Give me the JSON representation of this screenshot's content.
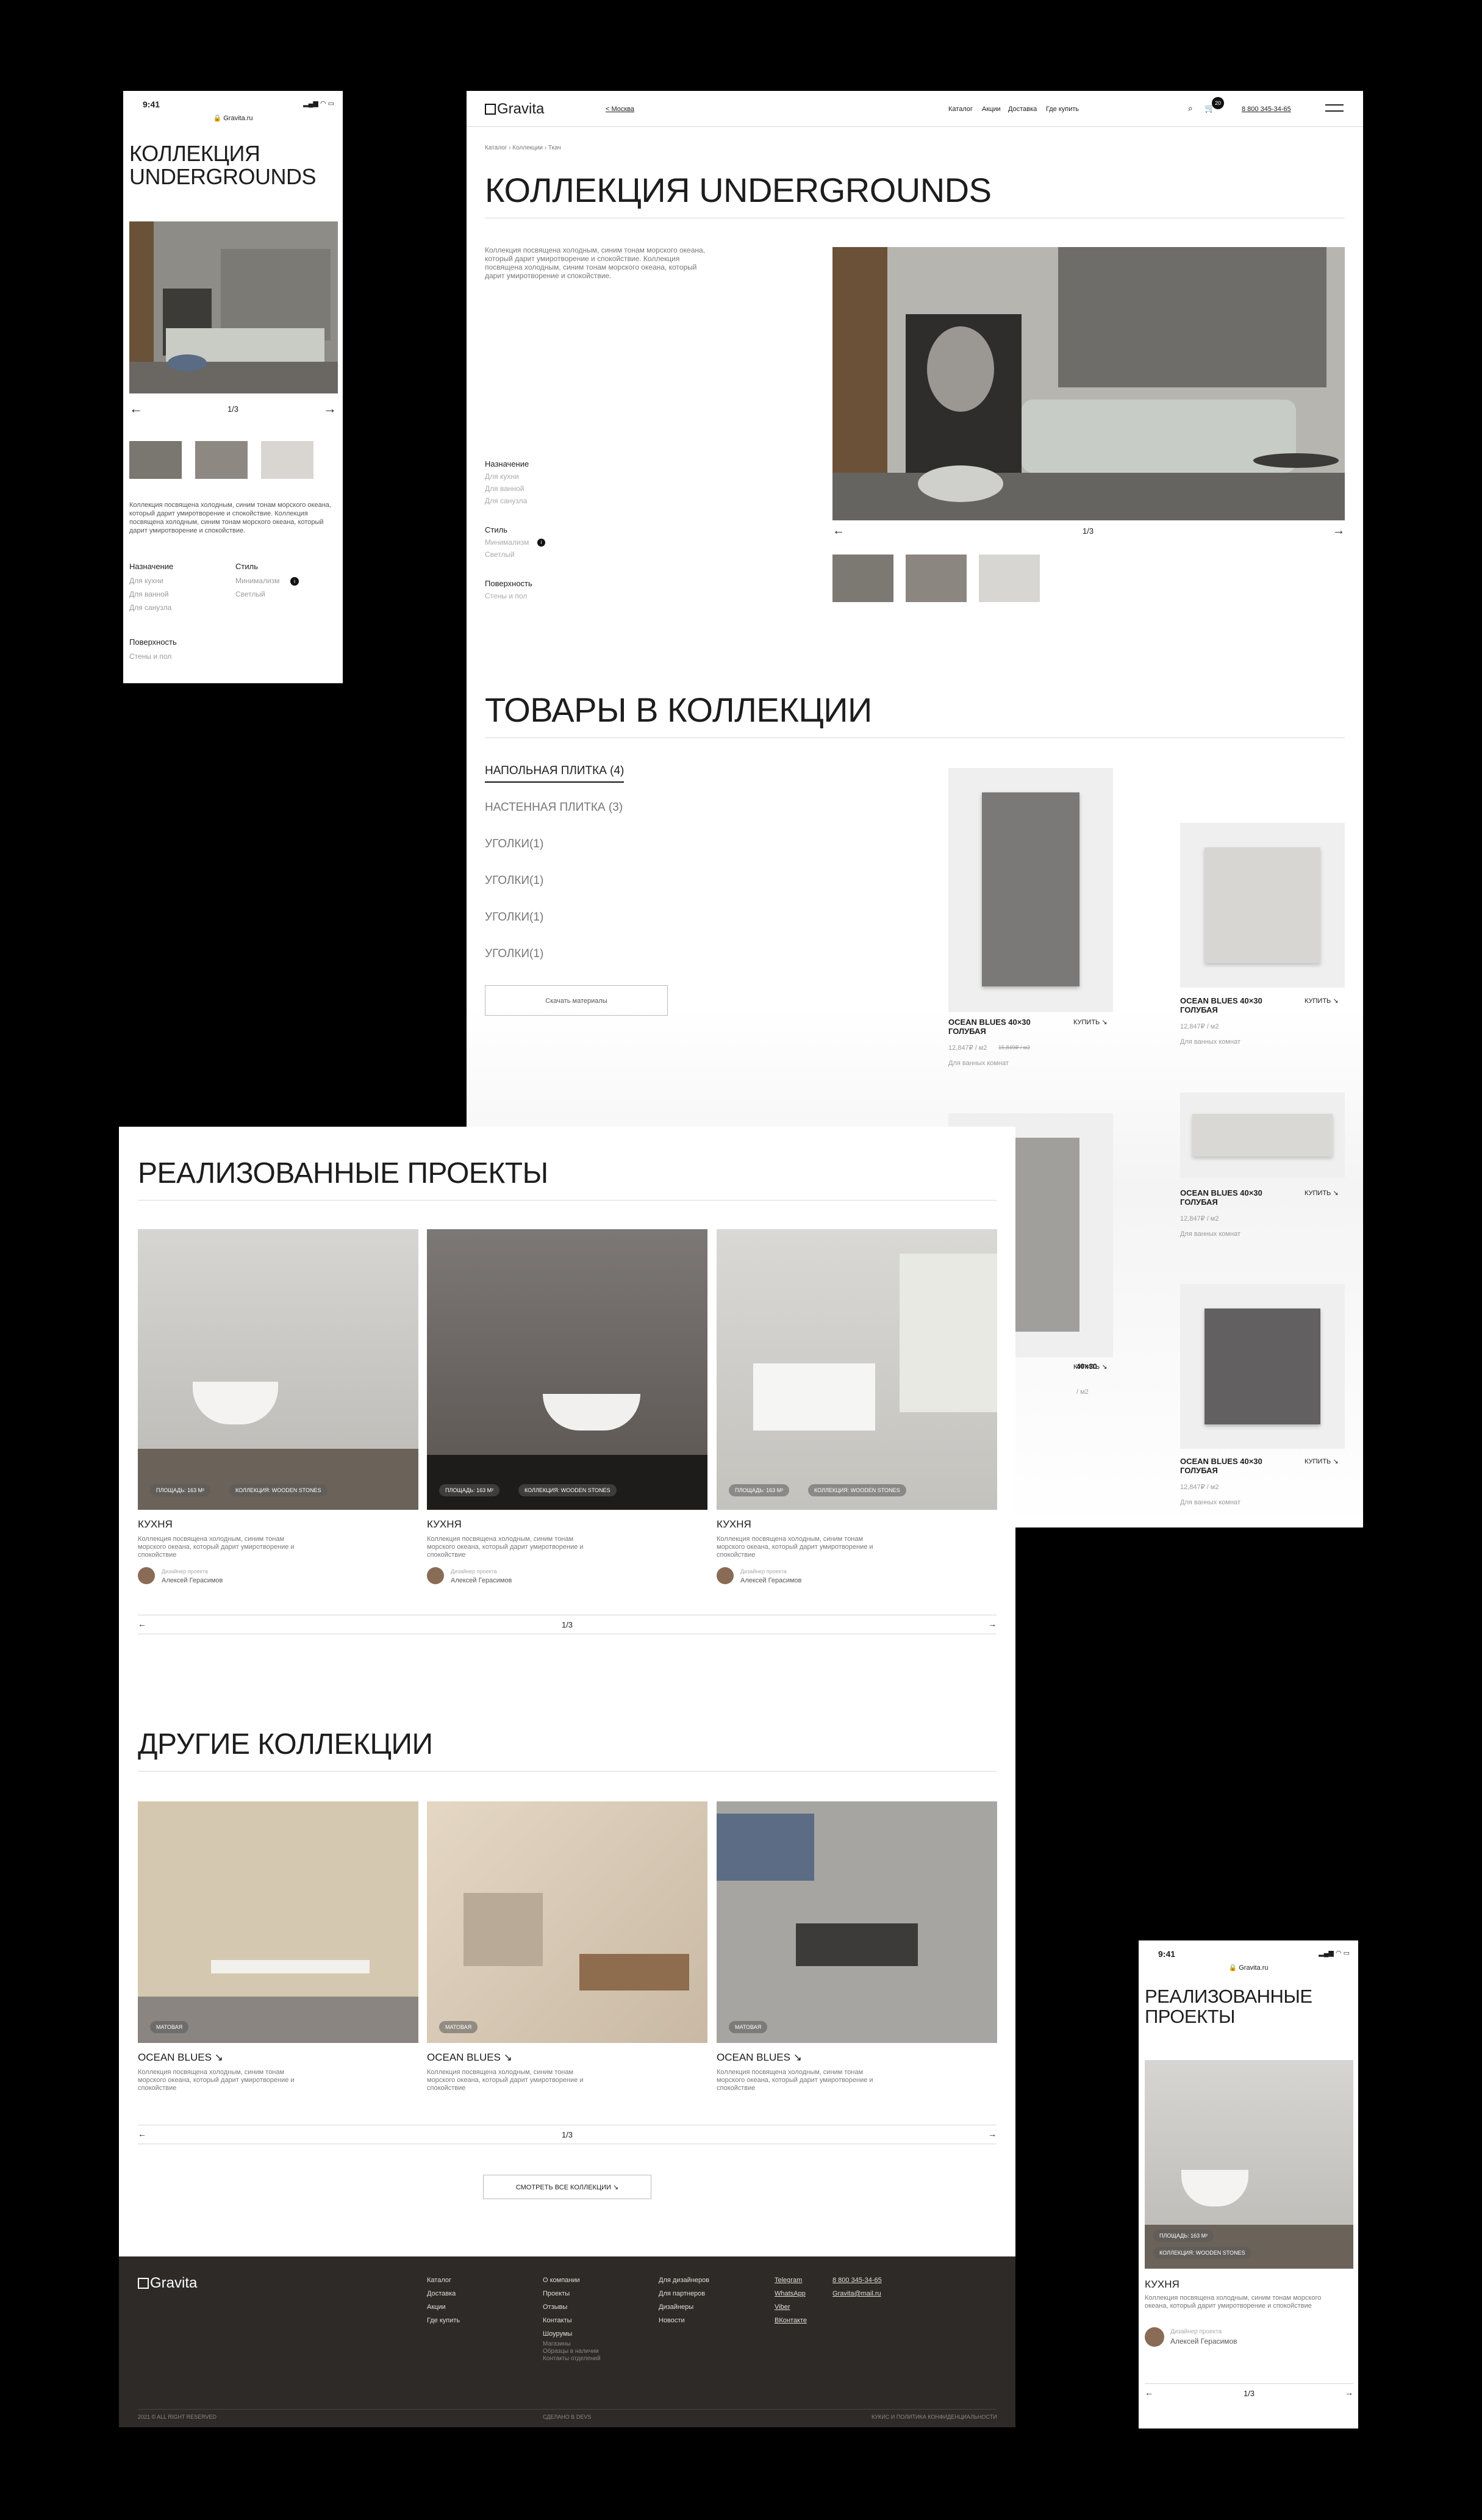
{
  "brand": {
    "logo_text": "Gravita"
  },
  "status_bar": {
    "time": "9:41",
    "url": "Gravita.ru"
  },
  "header": {
    "city": "< Москва",
    "nav": [
      "Каталог",
      "Акции",
      "Доставка",
      "Где купить"
    ],
    "cart_count": "20",
    "phone": "8 800 345-34-65"
  },
  "breadcrumb": [
    "Каталог",
    "Коллекции",
    "Ткач"
  ],
  "collection": {
    "title": "КОЛЛЕКЦИЯ UNDERGROUNDS",
    "title_mobile": "КОЛЛЕКЦИЯ UNDERGROUNDS",
    "description": "Коллекция посвящена холодным, синим тонам морского океана, который дарит умиротворение и спокойствие. Коллекция посвящена холодным, синим тонам морского океана, который дарит умиротворение и спокойствие.",
    "slide_counter": "1/3",
    "props": {
      "purpose_label": "Назначение",
      "purpose_values": [
        "Для кухни",
        "Для ванной",
        "Для санузла"
      ],
      "style_label": "Стиль",
      "style_values": [
        "Минимализм",
        "Светлый"
      ],
      "surface_label": "Поверхность",
      "surface_values": [
        "Стены и пол"
      ]
    }
  },
  "products_section": {
    "title": "ТОВАРЫ В КОЛЛЕКЦИИ",
    "categories": [
      "НАПОЛЬНАЯ ПЛИТКА (4)",
      "НАСТЕННАЯ ПЛИТКА (3)",
      "УГОЛКИ(1)",
      "УГОЛКИ(1)",
      "УГОЛКИ(1)",
      "УГОЛКИ(1)"
    ],
    "download_button": "Скачать материалы",
    "items": [
      {
        "name": "OCEAN BLUES 40×30 ГОЛУБАЯ",
        "buy": "КУПИТЬ",
        "price": "12,847₽ / м2",
        "old_price": "15,849₽ / м2",
        "usage": "Для ванных комнат"
      },
      {
        "name": "OCEAN BLUES 40×30 ГОЛУБАЯ",
        "buy": "КУПИТЬ",
        "price": "12,847₽ / м2",
        "old_price": "",
        "usage": "Для ванных комнат"
      },
      {
        "name": "OCEAN BLUES 40×30 ГОЛУБАЯ",
        "buy": "КУПИТЬ",
        "price": "12,847₽ / м2",
        "old_price": "",
        "usage": "Для ванных комнат"
      },
      {
        "name": "OCEAN BLUES 40×30 ГОЛУБАЯ",
        "buy": "КУПИТЬ",
        "price": "12,847₽ / м2",
        "old_price": "",
        "usage": "Для ванных комнат"
      },
      {
        "name": "40×30",
        "buy": "КУПИТЬ",
        "price": "/ м2",
        "old_price": "",
        "usage": ""
      }
    ]
  },
  "projects_section": {
    "title": "РЕАЛИЗОВАННЫЕ ПРОЕКТЫ",
    "title_mobile": "РЕАЛИЗОВАННЫЕ ПРОЕКТЫ",
    "counter": "1/3",
    "items": [
      {
        "area": "ПЛОЩАДЬ: 163 М²",
        "collection": "КОЛЛЕКЦИЯ: WOODEN STONES",
        "name": "КУХНЯ",
        "text": "Коллекция посвящена холодным, синим тонам морского океана, который дарит умиротворение и спокойствие",
        "designer_label": "Дизайнер проекта",
        "designer": "Алексей Герасимов"
      },
      {
        "area": "ПЛОЩАДЬ: 163 М²",
        "collection": "КОЛЛЕКЦИЯ: WOODEN STONES",
        "name": "КУХНЯ",
        "text": "Коллекция посвящена холодным, синим тонам морского океана, который дарит умиротворение и спокойствие",
        "designer_label": "Дизайнер проекта",
        "designer": "Алексей Герасимов"
      },
      {
        "area": "ПЛОЩАДЬ: 163 М²",
        "collection": "КОЛЛЕКЦИЯ: WOODEN STONES",
        "name": "КУХНЯ",
        "text": "Коллекция посвящена холодным, синим тонам морского океана, который дарит умиротворение и спокойствие",
        "designer_label": "Дизайнер проекта",
        "designer": "Алексей Герасимов"
      }
    ]
  },
  "other_collections": {
    "title": "ДРУГИЕ КОЛЛЕКЦИИ",
    "counter": "1/3",
    "see_all": "СМОТРЕТЬ ВСЕ КОЛЛЕКЦИИ",
    "items": [
      {
        "name": "OCEAN BLUES",
        "tag": "МАТОВАЯ",
        "text": "Коллекция посвящена холодным, синим тонам морского океана, который дарит умиротворение и спокойствие"
      },
      {
        "name": "OCEAN BLUES",
        "tag": "МАТОВАЯ",
        "text": "Коллекция посвящена холодным, синим тонам морского океана, который дарит умиротворение и спокойствие"
      },
      {
        "name": "OCEAN BLUES",
        "tag": "МАТОВАЯ",
        "text": "Коллекция посвящена холодным, синим тонам морского океана, который дарит умиротворение и спокойствие"
      }
    ]
  },
  "footer": {
    "col1": [
      "Каталог",
      "Доставка",
      "Акции",
      "Где купить"
    ],
    "col2": [
      "О компании",
      "Проекты",
      "Отзывы",
      "Контакты",
      "Шоурумы"
    ],
    "col2_sub": [
      "Магазины",
      "Образцы в наличии",
      "Контакты отделений"
    ],
    "col3": [
      "Для дизайнеров",
      "Для партнеров",
      "Дизайнеры",
      "Новости"
    ],
    "col4": [
      "Telegram",
      "WhatsApp",
      "Viber",
      "ВКонтакте"
    ],
    "phone": "8 800 345-34-65",
    "email": "Gravita@mail.ru",
    "copyright": "2021 © ALL RIGHT RESERVED",
    "made_by": "СДЕЛАНО В DEVS",
    "policy": "КУКИС И ПОЛИТИКА КОНФИДЕНЦИАЛЬНОСТИ"
  },
  "colors": {
    "footer_bg": "#2e2a27",
    "accent": "#1d1d1d",
    "muted": "#9a9a9a"
  }
}
